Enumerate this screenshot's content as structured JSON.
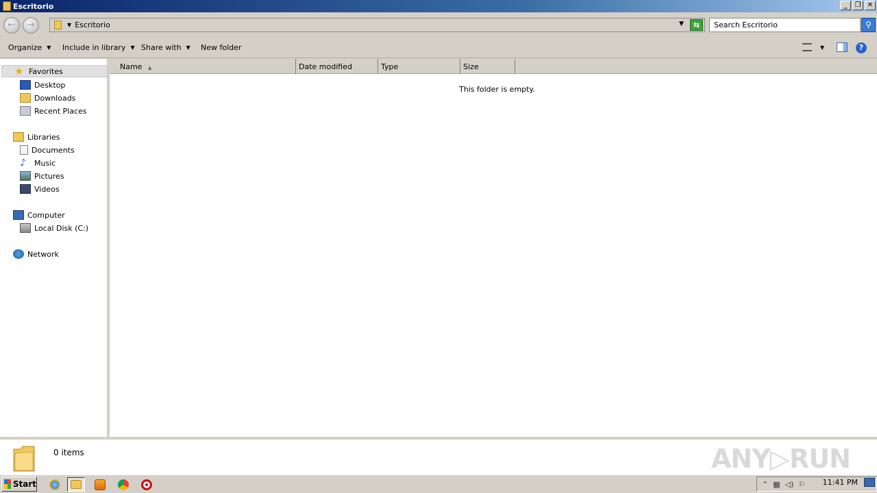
{
  "window": {
    "title": "Escritorio",
    "controls": {
      "minimize": "_",
      "restore": "❐",
      "close": "✕"
    }
  },
  "address": {
    "path": "Escritorio",
    "search_placeholder": "Search Escritorio"
  },
  "toolbar": {
    "organize": "Organize",
    "include_in_library": "Include in library",
    "share_with": "Share with",
    "new_folder": "New folder"
  },
  "nav": {
    "favorites": "Favorites",
    "desktop": "Desktop",
    "downloads": "Downloads",
    "recent_places": "Recent Places",
    "libraries": "Libraries",
    "documents": "Documents",
    "music": "Music",
    "pictures": "Pictures",
    "videos": "Videos",
    "computer": "Computer",
    "local_disk": "Local Disk (C:)",
    "network": "Network"
  },
  "columns": {
    "name": "Name",
    "date_modified": "Date modified",
    "type": "Type",
    "size": "Size"
  },
  "content": {
    "empty_message": "This folder is empty."
  },
  "details": {
    "item_count": "0 items"
  },
  "watermark": "ANY▷RUN",
  "taskbar": {
    "start_label": "Start",
    "clock": "11:41 PM",
    "apps": [
      "internet-explorer-icon",
      "explorer-icon",
      "media-player-icon",
      "chrome-icon",
      "opera-icon"
    ]
  },
  "colors": {
    "title_gradient_start": "#0a246a",
    "title_gradient_end": "#a6caf0",
    "chrome_bg": "#d4d0c8"
  }
}
